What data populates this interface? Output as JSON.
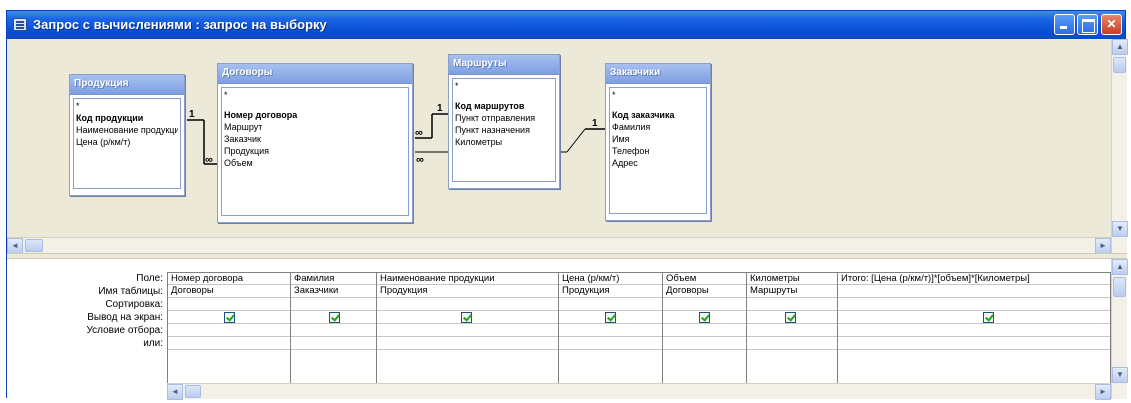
{
  "window": {
    "title": "Запрос с вычислениями : запрос на выборку",
    "buttons": {
      "minimize": "",
      "maximize": "",
      "close": "✕"
    }
  },
  "tables": [
    {
      "id": "produkcija",
      "title": "Продукция",
      "fields": [
        "*",
        "Код продукции",
        "Наименование продукции",
        "Цена (р/км/т)"
      ],
      "key_field": "Код продукции"
    },
    {
      "id": "dogovory",
      "title": "Договоры",
      "fields": [
        "*",
        "Номер договора",
        "Маршрут",
        "Заказчик",
        "Продукция",
        "Объем"
      ],
      "key_field": "Номер договора"
    },
    {
      "id": "marshruty",
      "title": "Маршруты",
      "fields": [
        "*",
        "Код маршрутов",
        "Пункт отправления",
        "Пункт назначения",
        "Километры"
      ],
      "key_field": "Код маршрутов"
    },
    {
      "id": "zakazchiki",
      "title": "Заказчики",
      "fields": [
        "*",
        "Код заказчика",
        "Фамилия",
        "Имя",
        "Телефон",
        "Адрес"
      ],
      "key_field": "Код заказчика"
    }
  ],
  "relation_labels": {
    "one": "1",
    "many": "∞"
  },
  "grid": {
    "row_labels": [
      "Поле:",
      "Имя таблицы:",
      "Сортировка:",
      "Вывод на экран:",
      "Условие отбора:",
      "или:"
    ],
    "columns": [
      {
        "field": "Номер договора",
        "table": "Договоры",
        "sort": "",
        "show": true
      },
      {
        "field": "Фамилия",
        "table": "Заказчики",
        "sort": "",
        "show": true
      },
      {
        "field": "Наименование продукции",
        "table": "Продукция",
        "sort": "",
        "show": true
      },
      {
        "field": "Цена (р/км/т)",
        "table": "Продукция",
        "sort": "",
        "show": true
      },
      {
        "field": "Объем",
        "table": "Договоры",
        "sort": "",
        "show": true
      },
      {
        "field": "Километры",
        "table": "Маршруты",
        "sort": "",
        "show": true
      },
      {
        "field": "Итого: [Цена (р/км/т)]*[объем]*[Километры]",
        "table": "",
        "sort": "",
        "show": true
      }
    ]
  },
  "icons": {
    "app": "query-icon",
    "scroll_left": "◄",
    "scroll_right": "►",
    "scroll_up": "▲",
    "scroll_down": "▼"
  }
}
